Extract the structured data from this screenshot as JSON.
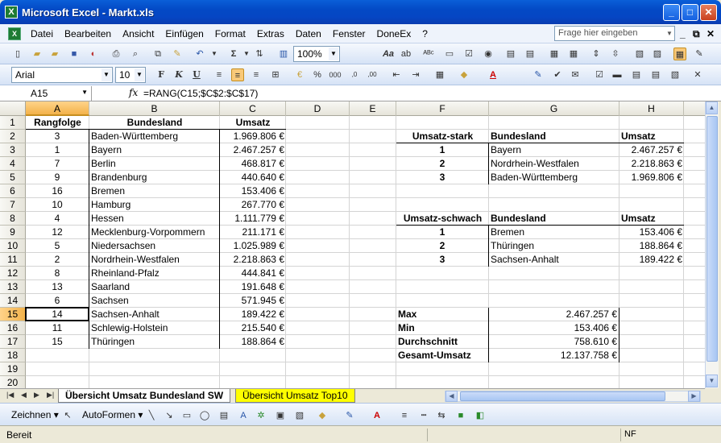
{
  "window": {
    "title": "Microsoft Excel - Markt.xls"
  },
  "menu": {
    "items": [
      "Datei",
      "Bearbeiten",
      "Ansicht",
      "Einfügen",
      "Format",
      "Extras",
      "Daten",
      "Fenster",
      "DoneEx",
      "?"
    ],
    "help_placeholder": "Frage hier eingeben"
  },
  "toolbar": {
    "zoom": "100%",
    "font": "Arial",
    "font_size": "10"
  },
  "formula_bar": {
    "name_box": "A15",
    "formula": "=RANG(C15;$C$2:$C$17)"
  },
  "columns": [
    "A",
    "B",
    "C",
    "D",
    "E",
    "F",
    "G",
    "H"
  ],
  "rows": [
    "1",
    "2",
    "3",
    "4",
    "5",
    "6",
    "7",
    "8",
    "9",
    "10",
    "11",
    "12",
    "13",
    "14",
    "15",
    "16",
    "17",
    "18",
    "19",
    "20"
  ],
  "table_left": {
    "headers": [
      "Rangfolge",
      "Bundesland",
      "Umsatz"
    ],
    "rows": [
      [
        "3",
        "Baden-Württemberg",
        "1.969.806 €"
      ],
      [
        "1",
        "Bayern",
        "2.467.257 €"
      ],
      [
        "7",
        "Berlin",
        "468.817 €"
      ],
      [
        "9",
        "Brandenburg",
        "440.640 €"
      ],
      [
        "16",
        "Bremen",
        "153.406 €"
      ],
      [
        "10",
        "Hamburg",
        "267.770 €"
      ],
      [
        "4",
        "Hessen",
        "1.111.779 €"
      ],
      [
        "12",
        "Mecklenburg-Vorpommern",
        "211.171 €"
      ],
      [
        "5",
        "Niedersachsen",
        "1.025.989 €"
      ],
      [
        "2",
        "Nordrhein-Westfalen",
        "2.218.863 €"
      ],
      [
        "8",
        "Rheinland-Pfalz",
        "444.841 €"
      ],
      [
        "13",
        "Saarland",
        "191.648 €"
      ],
      [
        "6",
        "Sachsen",
        "571.945 €"
      ],
      [
        "14",
        "Sachsen-Anhalt",
        "189.422 €"
      ],
      [
        "11",
        "Schlewig-Holstein",
        "215.540 €"
      ],
      [
        "15",
        "Thüringen",
        "188.864 €"
      ]
    ]
  },
  "top_strong": {
    "headers": [
      "Umsatz-stark",
      "Bundesland",
      "Umsatz"
    ],
    "rows": [
      [
        "1",
        "Bayern",
        "2.467.257 €"
      ],
      [
        "2",
        "Nordrhein-Westfalen",
        "2.218.863 €"
      ],
      [
        "3",
        "Baden-Württemberg",
        "1.969.806 €"
      ]
    ]
  },
  "top_weak": {
    "headers": [
      "Umsatz-schwach",
      "Bundesland",
      "Umsatz"
    ],
    "rows": [
      [
        "1",
        "Bremen",
        "153.406 €"
      ],
      [
        "2",
        "Thüringen",
        "188.864 €"
      ],
      [
        "3",
        "Sachsen-Anhalt",
        "189.422 €"
      ]
    ]
  },
  "stats": [
    [
      "Max",
      "2.467.257 €"
    ],
    [
      "Min",
      "153.406 €"
    ],
    [
      "Durchschnitt",
      "758.610 €"
    ],
    [
      "Gesamt-Umsatz",
      "12.137.758 €"
    ]
  ],
  "sheets": {
    "active": "Übersicht Umsatz Bundesland SW",
    "other": "Übersicht Umsatz Top10"
  },
  "drawing": {
    "draw_label": "Zeichnen",
    "autoshapes_label": "AutoFormen"
  },
  "status": {
    "text": "Bereit",
    "mode": "NF"
  }
}
